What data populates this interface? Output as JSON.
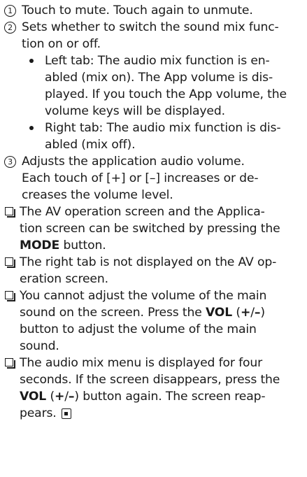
{
  "items": [
    {
      "marker": "1",
      "lines": [
        "Touch to mute. Touch again to unmute."
      ]
    },
    {
      "marker": "2",
      "lines": [
        "Sets whether to switch the sound mix func-",
        "tion on or off."
      ]
    },
    {
      "marker": "3",
      "lines": [
        "Adjusts the application audio volume.",
        "Each touch of [+] or [–] increases or de-",
        "creases the volume level."
      ]
    }
  ],
  "bullets": [
    {
      "lines": [
        "Left tab: The audio mix function is en-",
        "abled (mix on). The App volume is dis-",
        "played. If you touch the App volume, the",
        "volume keys will be displayed."
      ]
    },
    {
      "lines": [
        "Right tab: The audio mix function is dis-",
        "abled (mix off)."
      ]
    }
  ],
  "notes": {
    "n1": {
      "l1": "The AV operation screen and the Applica-",
      "l2": "tion screen can be switched by pressing the",
      "bold": "MODE",
      "l3_after": " button."
    },
    "n2": {
      "l1": "The right tab is not displayed on the AV op-",
      "l2": "eration screen."
    },
    "n3": {
      "l1": "You cannot adjust the volume of the main",
      "l2_before": "sound on the screen. Press the ",
      "bold": "VOL",
      "paren_open": " (",
      "plus": "+",
      "slash": "/",
      "minus": "–",
      "paren_close": ")",
      "l3": "button to adjust the volume of the main",
      "l4": "sound."
    },
    "n4": {
      "l1": "The audio mix menu is displayed for four",
      "l2": "seconds. If the screen disappears, press the",
      "bold": "VOL",
      "paren_open": " (",
      "plus": "+",
      "slash": "/",
      "minus": "–",
      "l3_after": ") button again. The screen reap-",
      "l4": "pears."
    }
  },
  "icons": {
    "note_marker": "note-checkbox-icon",
    "end_marker": "end-of-section-icon"
  }
}
